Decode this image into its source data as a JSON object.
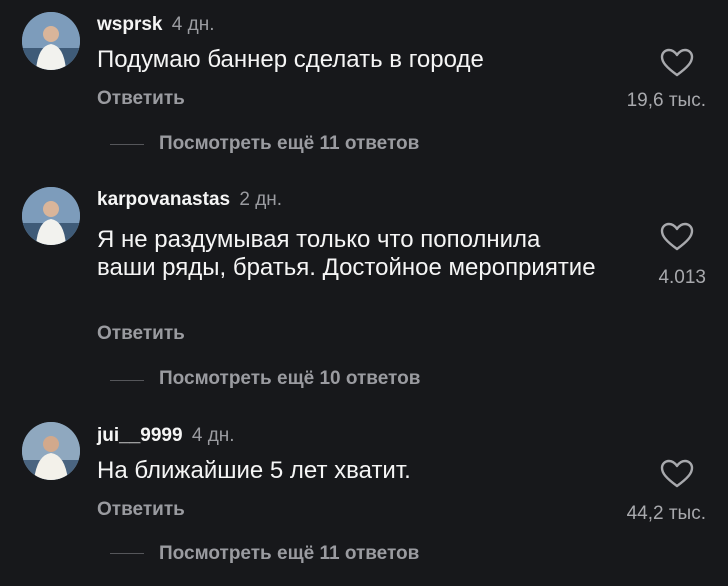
{
  "comments": [
    {
      "username": "wsprsk",
      "time": "4 дн.",
      "text": "Подумаю баннер сделать в городе",
      "reply_label": "Ответить",
      "likes": "19,6 тыс.",
      "view_replies": "Посмотреть ещё 11 ответов"
    },
    {
      "username": "karpovanastas",
      "time": "2 дн.",
      "text": "Я не раздумывая только что пополнила ваши ряды, братья. Достойное мероприятие",
      "reply_label": "Ответить",
      "likes": "4.013",
      "view_replies": "Посмотреть ещё 10 ответов"
    },
    {
      "username": "jui__9999",
      "time": "4 дн.",
      "text": "На ближайшие 5 лет хватит.",
      "reply_label": "Ответить",
      "likes": "44,2 тыс.",
      "view_replies": "Посмотреть ещё 11 ответов"
    }
  ],
  "colors": {
    "background": "#17181b",
    "primary_text": "#f5f5f5",
    "secondary_text": "#9a9ba0"
  },
  "icons": {
    "like": "heart-outline-icon"
  }
}
